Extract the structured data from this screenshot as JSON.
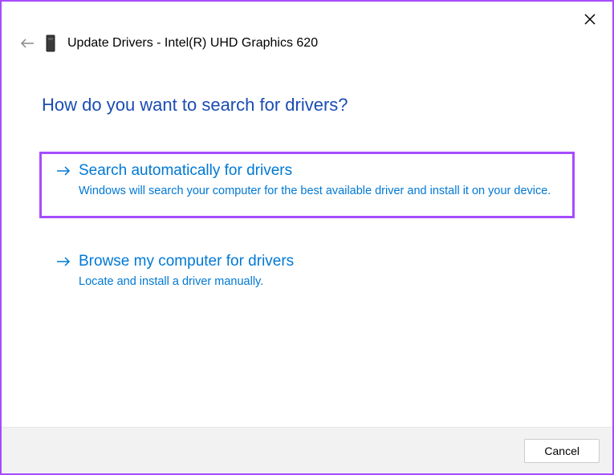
{
  "header": {
    "title": "Update Drivers - Intel(R) UHD Graphics 620"
  },
  "main": {
    "heading": "How do you want to search for drivers?",
    "options": [
      {
        "title": "Search automatically for drivers",
        "description": "Windows will search your computer for the best available driver and install it on your device.",
        "highlighted": true
      },
      {
        "title": "Browse my computer for drivers",
        "description": "Locate and install a driver manually.",
        "highlighted": false
      }
    ]
  },
  "footer": {
    "cancel_label": "Cancel"
  }
}
